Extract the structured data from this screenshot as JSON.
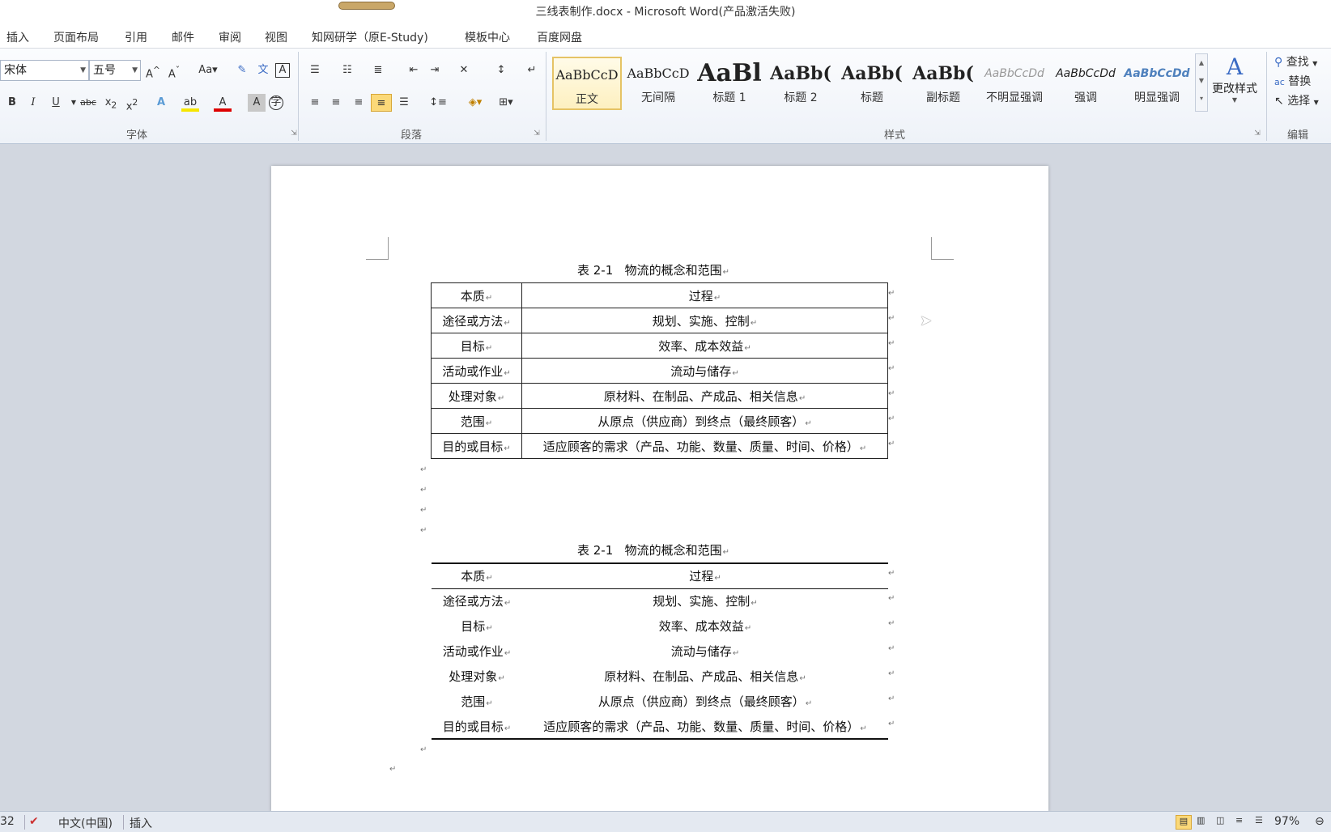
{
  "window": {
    "title": "三线表制作.docx - Microsoft Word(产品激活失败)"
  },
  "menu": [
    "插入",
    "页面布局",
    "引用",
    "邮件",
    "审阅",
    "视图",
    "知网研学（原E-Study)",
    "模板中心",
    "百度网盘"
  ],
  "font_group": {
    "font_name": "宋体",
    "font_size": "五号",
    "label": "字体"
  },
  "paragraph_group": {
    "label": "段落"
  },
  "styles_group": {
    "label": "样式",
    "items": [
      {
        "preview": "AaBbCcD",
        "name": "正文"
      },
      {
        "preview": "AaBbCcD",
        "name": "无间隔"
      },
      {
        "preview": "AaBl",
        "name": "标题 1"
      },
      {
        "preview": "AaBb(",
        "name": "标题 2"
      },
      {
        "preview": "AaBb(",
        "name": "标题"
      },
      {
        "preview": "AaBb(",
        "name": "副标题"
      },
      {
        "preview": "AaBbCcDd",
        "name": "不明显强调"
      },
      {
        "preview": "AaBbCcDd",
        "name": "强调"
      },
      {
        "preview": "AaBbCcDd",
        "name": "明显强调"
      }
    ],
    "change_styles": "更改样式"
  },
  "editing_group": {
    "label": "编辑",
    "find": "查找",
    "replace": "替换",
    "select": "选择"
  },
  "document": {
    "caption": "表 2-1   物流的概念和范围",
    "header": [
      "本质",
      "过程"
    ],
    "rows": [
      [
        "途径或方法",
        "规划、实施、控制"
      ],
      [
        "目标",
        "效率、成本效益"
      ],
      [
        "活动或作业",
        "流动与储存"
      ],
      [
        "处理对象",
        "原材料、在制品、产成品、相关信息"
      ],
      [
        "范围",
        "从原点（供应商）到终点（最终顾客）"
      ],
      [
        "目的或目标",
        "适应顾客的需求（产品、功能、数量、质量、时间、价格）"
      ]
    ]
  },
  "status": {
    "page": "32",
    "language": "中文(中国)",
    "mode": "插入",
    "zoom": "97%"
  }
}
